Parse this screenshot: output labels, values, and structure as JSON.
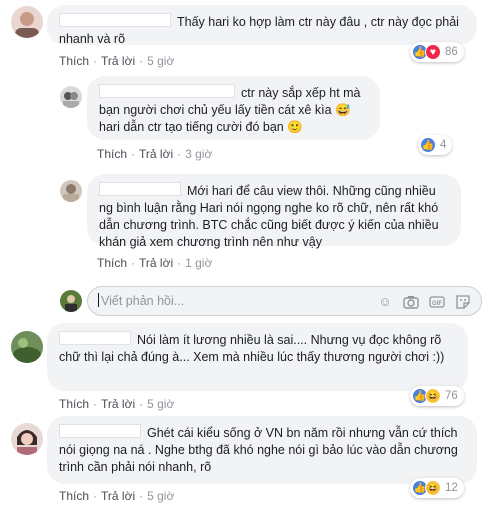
{
  "comments": [
    {
      "text": "Thấy hari ko hợp làm ctr này đâu , ctr này đọc phải nhanh và rõ",
      "like_label": "Thích",
      "reply_label": "Trả lời",
      "time": "5 giờ",
      "reactions": [
        "like-icon",
        "love-icon"
      ],
      "reaction_count": "86"
    },
    {
      "text": "ctr này sắp xếp ht mà bạn người chơi chủ yếu lấy tiền cát xê kìa 😅 hari dẫn ctr tạo tiếng cười đó bạn 🙂",
      "like_label": "Thích",
      "reply_label": "Trả lời",
      "time": "3 giờ",
      "reactions": [
        "like-icon"
      ],
      "reaction_count": "4"
    },
    {
      "text": "Mới hari để câu view thôi. Những cũng nhiều ng bình luận rằng Hari nói ngọng nghe ko rõ chữ, nên rất khó dẫn chương trình. BTC chắc cũng biết được ý kiến của nhiều khán giả xem chương trình nên như vậy",
      "like_label": "Thích",
      "reply_label": "Trả lời",
      "time": "1 giờ"
    },
    {
      "text": "Nói làm ít lương nhiều là sai.... Nhưng vụ đọc không rõ chữ thì lại chả đúng à... Xem mà nhiều lúc thấy thương người chơi :))",
      "like_label": "Thích",
      "reply_label": "Trả lời",
      "time": "5 giờ",
      "reactions": [
        "like-icon",
        "haha-icon"
      ],
      "reaction_count": "76"
    },
    {
      "text": "Ghét cái kiểu sống ở VN bn năm rồi nhưng vẫn cứ thích nói giọng na ná . Nghe bthg đã khó nghe nói gì bảo lúc vào dẫn chương trình cần phải nói nhanh, rõ",
      "like_label": "Thích",
      "reply_label": "Trả lời",
      "time": "5 giờ",
      "reactions": [
        "like-icon",
        "haha-icon"
      ],
      "reaction_count": "12"
    }
  ],
  "reply_input": {
    "placeholder": "Viết phản hồi...",
    "icons": [
      "emoji-icon",
      "camera-icon",
      "gif-icon",
      "sticker-icon"
    ]
  },
  "colors": {
    "bubble": "#f2f3f5",
    "like": "#4a7fe3",
    "love": "#f0284a",
    "haha": "#f7c64a"
  }
}
